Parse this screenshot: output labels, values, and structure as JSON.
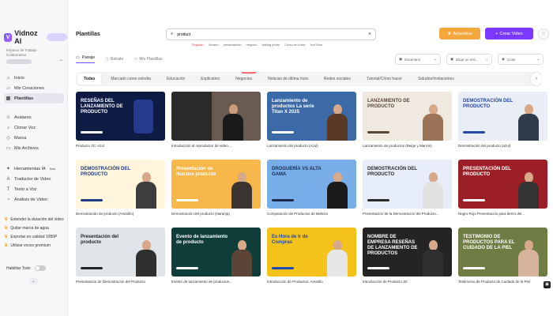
{
  "app": {
    "logo_text": "Vidnoz AI"
  },
  "sidebar": {
    "workspace_line1": "Espacio de Trabajo",
    "workspace_line2": "Colaborativo",
    "items_main": [
      {
        "label": "Inicio",
        "icon": "home-icon",
        "glyph": "⌂"
      },
      {
        "label": "Mis Creaciones",
        "icon": "folder-icon",
        "glyph": "▱"
      },
      {
        "label": "Plantillas",
        "icon": "template-icon",
        "glyph": "▦"
      }
    ],
    "items_create": [
      {
        "label": "Avatares",
        "icon": "avatar-icon",
        "glyph": "☺"
      },
      {
        "label": "Clonar Voz",
        "icon": "voice-icon",
        "glyph": "♪"
      },
      {
        "label": "Marca",
        "icon": "brand-icon",
        "glyph": "◇"
      },
      {
        "label": "Mis Archivos",
        "icon": "files-icon",
        "glyph": "▭"
      }
    ],
    "items_tools": [
      {
        "label": "Herramientas IA",
        "icon": "tools-icon",
        "glyph": "✦",
        "badge": "Más"
      },
      {
        "label": "Traductor de Video",
        "icon": "translate-icon",
        "glyph": "A"
      },
      {
        "label": "Texto a Voz",
        "icon": "text-voice-icon",
        "glyph": "T"
      },
      {
        "label": "Análisis de Video",
        "icon": "analysis-icon",
        "glyph": "◔"
      }
    ],
    "promo": [
      "Extender la duración del video",
      "Quitar marca de agua",
      "Exportar en calidad 1080P",
      "Utilizar voces premium"
    ],
    "toggle_label": "Habilitar Todo"
  },
  "header": {
    "title": "Plantillas",
    "search_value": "product",
    "popular_label": "Popular:",
    "popular_tags": [
      "Verano",
      "presentación",
      "negocio",
      "talking photo",
      "Curso en línea",
      "YouTube"
    ],
    "upgrade_label": "Actualizar",
    "create_label": "Crear Video"
  },
  "orientation_tabs": [
    "Paisaje",
    "Retrato",
    "Mis Plantillas"
  ],
  "filters": [
    "Escenario",
    "Elige un esti...",
    "Color"
  ],
  "categories": [
    {
      "label": "Todas",
      "active": true
    },
    {
      "label": "Marcado como estrella"
    },
    {
      "label": "Educación"
    },
    {
      "label": "Explicativo"
    },
    {
      "label": "Negocios",
      "badge": "POPULAR"
    },
    {
      "label": "Noticias de última hora"
    },
    {
      "label": "Redes sociales"
    },
    {
      "label": "Tutorial/Cómo hacer"
    },
    {
      "label": "Saludos/Invitaciones"
    }
  ],
  "templates": [
    {
      "title": "Producto 3C: Azul",
      "thumb_text": "RESEÑAS DEL LANZAMIENTO DE PRODUCTO",
      "bg": "#0d1b45",
      "text_color": "#ffffff",
      "kind": "phone"
    },
    {
      "title": "Introducción al reproductor de video...",
      "thumb_text": "",
      "bg": "#1e1d1c",
      "text_color": "#ffffff",
      "kind": "video"
    },
    {
      "title": "Lanzamiento del producto (Azul)",
      "thumb_text": "Lanzamiento de productos La serie Titan X 2025",
      "bg": "#3c6aa6",
      "text_color": "#ffffff",
      "kind": "person",
      "person_color": "#5a3a25"
    },
    {
      "title": "Lanzamiento de productos (Beige y Marrón)",
      "thumb_text": "LANZAMIENTO DE PRODUCTO",
      "bg": "#efe9df",
      "text_color": "#5b4636",
      "kind": "person",
      "person_color": "#9b7356"
    },
    {
      "title": "Demostración del producto (azul)",
      "thumb_text": "DEMOSTRACIÓN DEL PRODUCTO",
      "bg": "#e9edf6",
      "text_color": "#2447a5",
      "kind": "person",
      "person_color": "#2f3a4b"
    },
    {
      "title": "Demostración de producto (Amarillo)",
      "thumb_text": "DEMOSTRACIÓN DEL PRODUCTO",
      "bg": "#fff6dd",
      "text_color": "#203a86",
      "kind": "person",
      "person_color": "#3d3d3d"
    },
    {
      "title": "Demostración del producto (Naranja)",
      "thumb_text": "Presentación de Nuestro producto",
      "bg": "#f7b74a",
      "text_color": "#ffffff",
      "kind": "person",
      "person_color": "#3c3430"
    },
    {
      "title": "Comparación de Productos de Belleza",
      "thumb_text": "DROGUERÍA VS ALTA GAMA",
      "bg": "#77aee8",
      "text_color": "#1c2b4d",
      "kind": "person",
      "person_color": "#1b1b1b"
    },
    {
      "title": "Presentación de la Demostración del Producto...",
      "thumb_text": "DEMOSTRACIÓN DEL PRODUCTO",
      "bg": "#e8eef9",
      "text_color": "#2b2b2b",
      "kind": "person",
      "person_color": "#e2e2e2"
    },
    {
      "title": "Negro Rojo Presentación para demo del...",
      "thumb_text": "PRESENTACIÓN DEL PRODUCTO",
      "bg": "#9c1f27",
      "text_color": "#ffffff",
      "kind": "person",
      "person_color": "#333333"
    },
    {
      "title": "Presentación de Demostración del Producto",
      "thumb_text": "Presentación del producto",
      "bg": "#dfe5e9",
      "text_color": "#242424",
      "kind": "person",
      "person_color": "#2f2f2f"
    },
    {
      "title": "Evento de lanzamiento de productos...",
      "thumb_text": "Evento de lanzamiento de producto",
      "bg": "#0e3d3a",
      "text_color": "#ffffff",
      "kind": "person",
      "person_color": "#5c4536"
    },
    {
      "title": "Introducción de Productos: Amarillo",
      "thumb_text": "Es Hora de Ir de Compras",
      "bg": "#f3c319",
      "text_color": "#1f49b7",
      "kind": "person",
      "person_color": "#e7e7e7"
    },
    {
      "title": "Introducción de Producto 3C",
      "thumb_text": "NOMBRE DE EMPRESA RESEÑAS DE LANZAMIENTO DE PRODUCTOS",
      "bg": "#242424",
      "text_color": "#ffffff",
      "kind": "person",
      "person_color": "#303030"
    },
    {
      "title": "Testimonio de Producto de Cuidado de la Piel",
      "thumb_text": "TESTIMONIO DE PRODUCTOS PARA EL CUIDADO DE LA PIEL",
      "bg": "#6f7c43",
      "text_color": "#ffffff",
      "kind": "person",
      "person_color": "#d6b49b"
    }
  ]
}
